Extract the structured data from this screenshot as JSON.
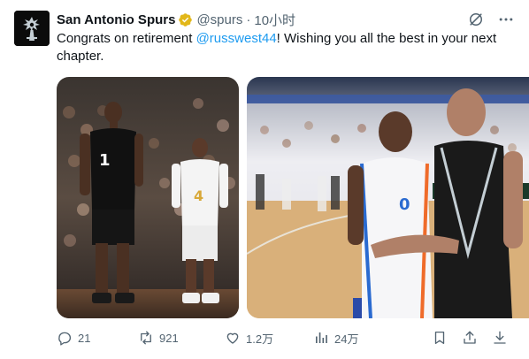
{
  "author": {
    "name": "San Antonio Spurs",
    "handle": "@spurs",
    "separator": "·",
    "time": "10小时"
  },
  "tweet": {
    "text_before": "Congrats on retirement ",
    "mention": "@russwest44",
    "text_after": "! Wishing you all the best in your next chapter."
  },
  "media": [
    {
      "alt_icon": "photo-spurs-players"
    },
    {
      "alt_icon": "photo-handshake"
    }
  ],
  "stats": {
    "replies": "21",
    "reposts": "921",
    "likes": "1.2万",
    "views": "24万"
  },
  "colors": {
    "accent": "#1d9bf0",
    "muted": "#536471",
    "verified_gold": "#e2b719",
    "text": "#0f1419"
  }
}
